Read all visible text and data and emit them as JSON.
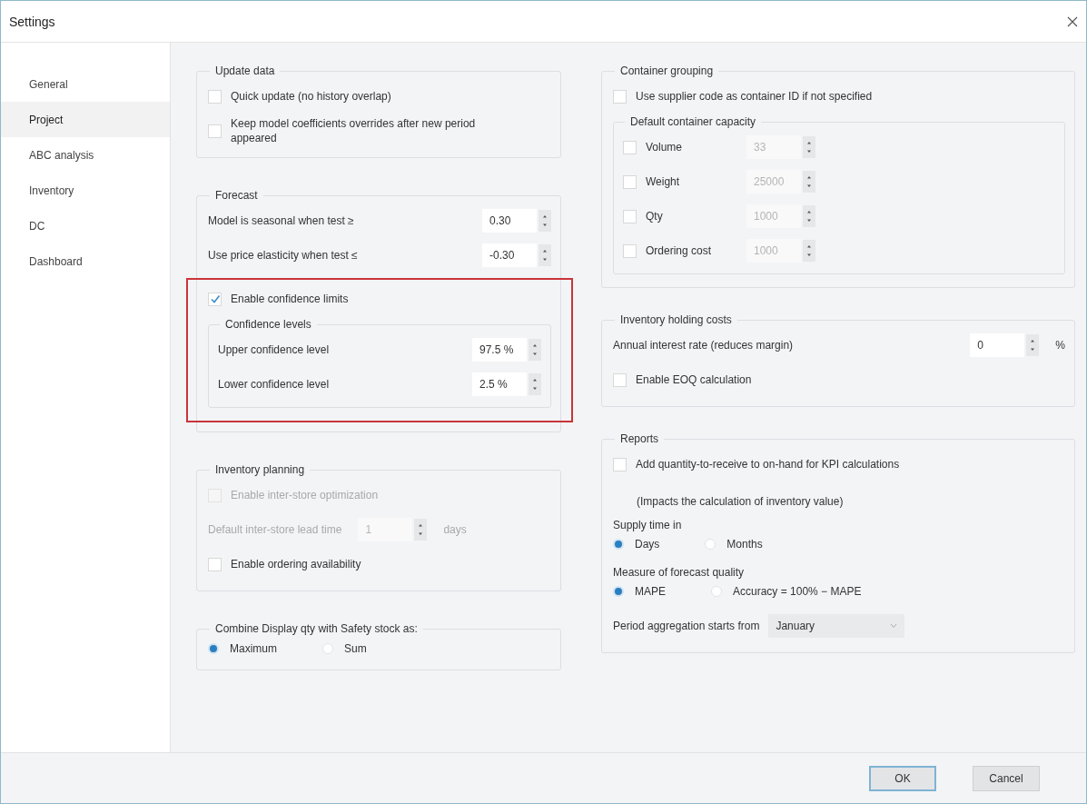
{
  "window": {
    "title": "Settings"
  },
  "sidebar": {
    "items": [
      {
        "label": "General",
        "selected": false
      },
      {
        "label": "Project",
        "selected": true
      },
      {
        "label": "ABC analysis",
        "selected": false
      },
      {
        "label": "Inventory",
        "selected": false
      },
      {
        "label": "DC",
        "selected": false
      },
      {
        "label": "Dashboard",
        "selected": false
      }
    ]
  },
  "left_groups": [
    {
      "title": "Update data",
      "rows": [
        {
          "kind": "checkbox",
          "label": "Quick update (no history overlap)",
          "checked": false,
          "disabled": false
        },
        {
          "kind": "checkbox",
          "label": "Keep model coefficients overrides after new period appeared",
          "checked": false,
          "disabled": false
        }
      ]
    },
    {
      "title": "Forecast",
      "rows": [
        {
          "kind": "spin",
          "label": "Model is seasonal when test ≥",
          "value": "0.30",
          "disabled": false
        },
        {
          "kind": "spin",
          "label": "Use price elasticity when test ≤",
          "value": "-0.30",
          "disabled": false
        },
        {
          "kind": "highlight",
          "rows": [
            {
              "kind": "checkbox",
              "label": "Enable confidence limits",
              "checked": true,
              "disabled": false
            },
            {
              "kind": "subgroup",
              "title": "Confidence levels",
              "rows": [
                {
                  "kind": "spin",
                  "label": "Upper confidence level",
                  "value": "97.5 %",
                  "disabled": false
                },
                {
                  "kind": "spin",
                  "label": "Lower confidence level",
                  "value": "2.5 %",
                  "disabled": false
                }
              ]
            }
          ]
        }
      ]
    },
    {
      "title": "Inventory planning",
      "rows": [
        {
          "kind": "checkbox",
          "label": "Enable inter-store optimization",
          "checked": false,
          "disabled": true
        },
        {
          "kind": "spin",
          "label": "Default inter-store lead time",
          "value": "1",
          "unit": "days",
          "disabled": true
        },
        {
          "kind": "checkbox",
          "label": "Enable ordering availability",
          "checked": false,
          "disabled": false
        }
      ]
    },
    {
      "title": "Combine Display qty with Safety stock as:",
      "rows": [
        {
          "kind": "radios",
          "options": [
            {
              "label": "Maximum",
              "selected": true
            },
            {
              "label": "Sum",
              "selected": false
            }
          ]
        }
      ]
    }
  ],
  "right_groups": [
    {
      "title": "Container grouping",
      "rows": [
        {
          "kind": "checkbox",
          "label": "Use supplier code as container ID if not specified",
          "checked": false,
          "disabled": false
        },
        {
          "kind": "subgroup",
          "title": "Default container capacity",
          "rows": [
            {
              "kind": "checkspin",
              "label": "Volume",
              "checked": false,
              "value": "33",
              "disabled": true
            },
            {
              "kind": "checkspin",
              "label": "Weight",
              "checked": false,
              "value": "25000",
              "disabled": true
            },
            {
              "kind": "checkspin",
              "label": "Qty",
              "checked": false,
              "value": "1000",
              "disabled": true
            },
            {
              "kind": "checkspin",
              "label": "Ordering cost",
              "checked": false,
              "value": "1000",
              "disabled": true
            }
          ]
        }
      ]
    },
    {
      "title": "Inventory holding costs",
      "rows": [
        {
          "kind": "spin",
          "label": "Annual interest rate (reduces margin)",
          "value": "0",
          "unit": "%",
          "disabled": false
        },
        {
          "kind": "checkbox",
          "label": "Enable EOQ calculation",
          "checked": false,
          "disabled": false
        }
      ]
    },
    {
      "title": "Reports",
      "rows": [
        {
          "kind": "checkbox",
          "label": "Add quantity-to-receive to on-hand for KPI calculations",
          "checked": false,
          "disabled": false
        },
        {
          "kind": "note",
          "text": "(Impacts the calculation of inventory value)"
        },
        {
          "kind": "label",
          "text": "Supply time in"
        },
        {
          "kind": "radios",
          "options": [
            {
              "label": "Days",
              "selected": true
            },
            {
              "label": "Months",
              "selected": false
            }
          ]
        },
        {
          "kind": "label",
          "text": "Measure of forecast quality"
        },
        {
          "kind": "radios",
          "options": [
            {
              "label": "MAPE",
              "selected": true
            },
            {
              "label": "Accuracy = 100% − MAPE",
              "selected": false
            }
          ]
        },
        {
          "kind": "select",
          "label": "Period aggregation starts from",
          "value": "January"
        }
      ]
    }
  ],
  "buttons": [
    {
      "label": "OK",
      "default": true
    },
    {
      "label": "Cancel",
      "default": false
    }
  ]
}
